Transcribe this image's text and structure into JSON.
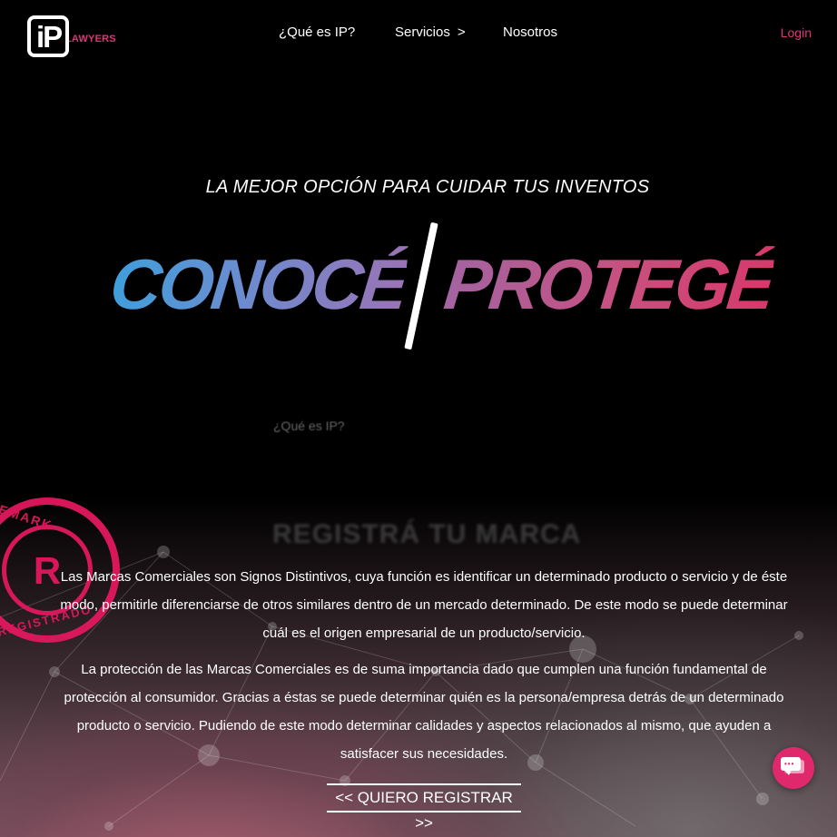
{
  "header": {
    "logo_mark": "iP",
    "logo_text": "LAWYERS",
    "nav": [
      "¿Qué es IP?",
      "Servicios",
      "Nosotros"
    ],
    "nav_chevron": ">",
    "login": "Login"
  },
  "hero": {
    "tagline": "LA MEJOR OPCIÓN PARA CUIDAR TUS INVENTOS",
    "left_word": "CONOCÉ",
    "right_word": "PROTEGÉ"
  },
  "section": {
    "ghost_link": "¿Qué es IP?",
    "ghost_title": "REGISTRÁ TU MARCA",
    "stamp_top": "DEMARK",
    "stamp_center": "R",
    "stamp_bottom": "REGISTRADO",
    "paragraph_1": "Las Marcas Comerciales son Signos Distintivos, cuya función es identificar un determinado producto o servicio y de éste modo, permitirle diferenciarse de otros similares dentro de un mercado determinado. De este modo se puede determinar cuál es el origen empresarial de un producto/servicio.",
    "paragraph_2": "La protección de las Marcas Comerciales es de suma importancia dado que cumplen una función fundamental de protección al consumidor. Gracias a éstas se puede determinar quién es la persona/empresa detrás de un determinado producto o servicio. Pudiendo de este modo determinar calidades y aspectos relacionados al mismo, que ayuden a satisfacer sus necesidades.",
    "cta": "<< QUIERO REGISTRAR >>"
  },
  "chat": {
    "icon": "chat-icon",
    "dots": "•••"
  },
  "colors": {
    "accent": "#e2337a",
    "background": "#000000",
    "hero_left_gradient": [
      "#3f9fdc",
      "#9b73b5"
    ],
    "hero_right_gradient": [
      "#a364a2",
      "#d7396b"
    ]
  }
}
